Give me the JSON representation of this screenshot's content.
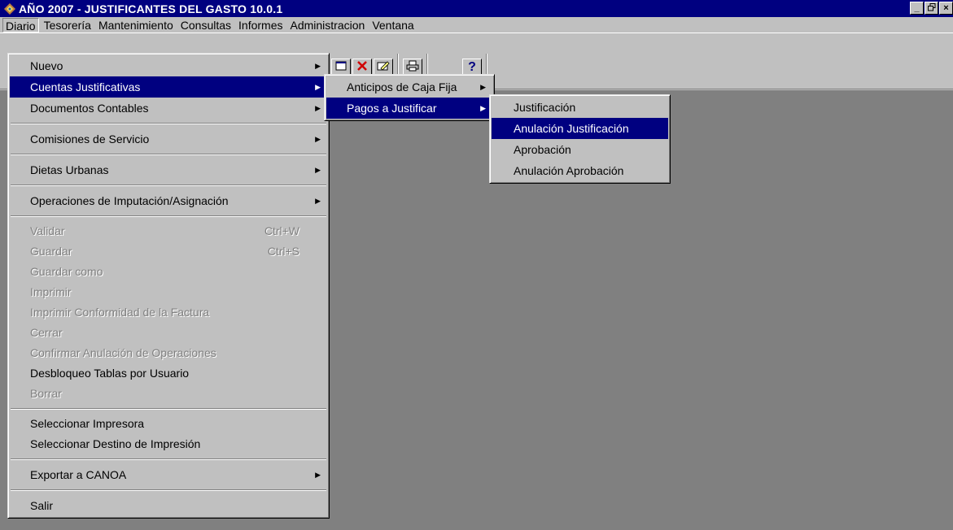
{
  "window": {
    "title": "AÑO 2007 - JUSTIFICANTES DEL GASTO 10.0.1",
    "controls": [
      "_",
      "8",
      "×"
    ]
  },
  "menubar": {
    "items": [
      {
        "label": "Diario"
      },
      {
        "label": "Tesorería"
      },
      {
        "label": "Mantenimiento"
      },
      {
        "label": "Consultas"
      },
      {
        "label": "Informes"
      },
      {
        "label": "Administracion"
      },
      {
        "label": "Ventana"
      }
    ]
  },
  "toolbar": {
    "icons": [
      "window-icon",
      "delete-icon",
      "edit-icon",
      "print-icon",
      "help-icon"
    ],
    "help_label": "?"
  },
  "diario_menu": {
    "group1": [
      {
        "label": "Nuevo",
        "arrow": "▶"
      },
      {
        "label": "Cuentas Justificativas",
        "arrow": "▶"
      },
      {
        "label": "Documentos Contables",
        "arrow": "▶"
      }
    ],
    "comisiones": {
      "label": "Comisiones de Servicio",
      "arrow": "▶"
    },
    "dietas": {
      "label": "Dietas Urbanas",
      "arrow": "▶"
    },
    "operaciones": {
      "label": "Operaciones de Imputación/Asignación",
      "arrow": "▶"
    },
    "group2": [
      {
        "label": "Validar",
        "shortcut": "Ctrl+W"
      },
      {
        "label": "Guardar",
        "shortcut": "Ctrl+S"
      },
      {
        "label": "Guardar como"
      },
      {
        "label": "Imprimir"
      },
      {
        "label": "Imprimir Conformidad de la Factura"
      },
      {
        "label": "Cerrar"
      },
      {
        "label": "Confirmar Anulación de Operaciones"
      },
      {
        "label": "Desbloqueo Tablas por Usuario"
      },
      {
        "label": "Borrar"
      }
    ],
    "group3": [
      {
        "label": "Seleccionar Impresora"
      },
      {
        "label": "Seleccionar Destino de Impresión"
      }
    ],
    "exportar": {
      "label": "Exportar a CANOA",
      "arrow": "▶"
    },
    "salir": {
      "label": "Salir"
    }
  },
  "cuentas_menu": {
    "items": [
      {
        "label": "Anticipos de Caja Fija",
        "arrow": "▶"
      },
      {
        "label": "Pagos a Justificar",
        "arrow": "▶"
      }
    ]
  },
  "pagos_menu": {
    "items": [
      {
        "label": "Justificación"
      },
      {
        "label": "Anulación Justificación"
      },
      {
        "label": "Aprobación"
      },
      {
        "label": "Anulación Aprobación"
      }
    ]
  },
  "colors": {
    "titlebar": "#000080",
    "face": "#c0c0c0",
    "workspace": "#808080",
    "highlight": "#000080"
  }
}
